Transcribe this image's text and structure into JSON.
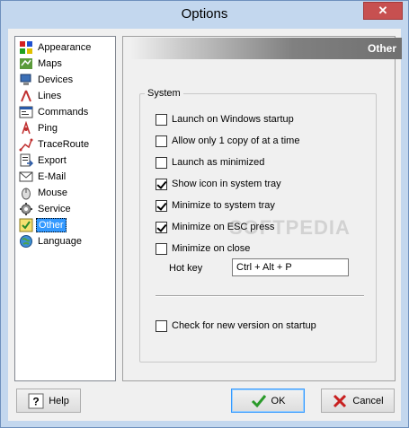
{
  "window": {
    "title": "Options",
    "close_label": "✕"
  },
  "tree": {
    "items": [
      {
        "label": "Appearance",
        "icon": "appearance-icon"
      },
      {
        "label": "Maps",
        "icon": "maps-icon"
      },
      {
        "label": "Devices",
        "icon": "devices-icon"
      },
      {
        "label": "Lines",
        "icon": "lines-icon"
      },
      {
        "label": "Commands",
        "icon": "commands-icon"
      },
      {
        "label": "Ping",
        "icon": "ping-icon"
      },
      {
        "label": "TraceRoute",
        "icon": "traceroute-icon"
      },
      {
        "label": "Export",
        "icon": "export-icon"
      },
      {
        "label": "E-Mail",
        "icon": "email-icon"
      },
      {
        "label": "Mouse",
        "icon": "mouse-icon"
      },
      {
        "label": "Service",
        "icon": "service-icon"
      },
      {
        "label": "Other",
        "icon": "other-icon",
        "selected": true
      },
      {
        "label": "Language",
        "icon": "language-icon"
      }
    ]
  },
  "panel": {
    "header": "Other",
    "group_title": "System",
    "options": [
      {
        "label": "Launch on Windows startup",
        "checked": false
      },
      {
        "label": "Allow only 1 copy of at a time",
        "checked": false
      },
      {
        "label": "Launch as minimized",
        "checked": false
      },
      {
        "label": "Show icon in system tray",
        "checked": true
      },
      {
        "label": "Minimize to system tray",
        "checked": true
      },
      {
        "label": "Minimize on ESC press",
        "checked": true
      },
      {
        "label": "Minimize on close",
        "checked": false
      }
    ],
    "hotkey": {
      "label": "Hot key",
      "value": "Ctrl + Alt + P"
    },
    "update_check": {
      "label": "Check for new version on startup",
      "checked": false
    }
  },
  "buttons": {
    "help": "Help",
    "ok": "OK",
    "cancel": "Cancel"
  },
  "watermark": "SOFTPEDIA"
}
